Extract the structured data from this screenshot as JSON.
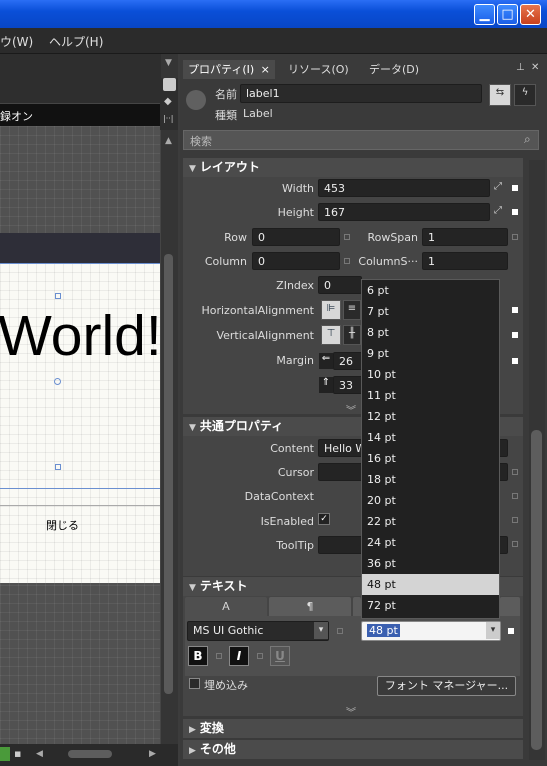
{
  "menubar": {
    "items": [
      "ウ(W)",
      "ヘルプ(H)"
    ]
  },
  "designer": {
    "header_text": "録オン",
    "label_content": "World!",
    "button_content": "閉じる"
  },
  "tabs": [
    {
      "label": "プロパティ(I)",
      "close": "×"
    },
    {
      "label": "リソース(O)"
    },
    {
      "label": "データ(D)"
    }
  ],
  "object": {
    "name_label": "名前",
    "name_value": "label1",
    "type_label": "種類",
    "type_value": "Label"
  },
  "search": {
    "placeholder": "検索"
  },
  "layout": {
    "title": "レイアウト",
    "width_label": "Width",
    "width_value": "453",
    "height_label": "Height",
    "height_value": "167",
    "row_label": "Row",
    "row_value": "0",
    "rowspan_label": "RowSpan",
    "rowspan_value": "1",
    "column_label": "Column",
    "column_value": "0",
    "columnspan_label": "ColumnS···",
    "columnspan_value": "1",
    "zindex_label": "ZIndex",
    "zindex_value": "0",
    "halign_label": "HorizontalAlignment",
    "valign_label": "VerticalAlignment",
    "margin_label": "Margin",
    "margin_left": "26",
    "margin_top": "33"
  },
  "common": {
    "title": "共通プロパティ",
    "content_label": "Content",
    "content_value": "Hello W",
    "cursor_label": "Cursor",
    "datacontext_label": "DataContext",
    "isenabled_label": "IsEnabled",
    "tooltip_label": "ToolTip"
  },
  "text": {
    "title": "テキスト",
    "font_family": "MS UI Gothic",
    "font_size": "48 pt",
    "bold": "B",
    "italic": "I",
    "underline": "U",
    "embed_label": "埋め込み",
    "font_manager_button": "フォント マネージャー..."
  },
  "font_sizes": [
    "6 pt",
    "7 pt",
    "8 pt",
    "9 pt",
    "10 pt",
    "11 pt",
    "12 pt",
    "14 pt",
    "16 pt",
    "18 pt",
    "20 pt",
    "22 pt",
    "24 pt",
    "36 pt",
    "48 pt",
    "72 pt"
  ],
  "selected_font_size": "48 pt",
  "transform": {
    "title": "変換"
  },
  "other": {
    "title": "その他"
  }
}
